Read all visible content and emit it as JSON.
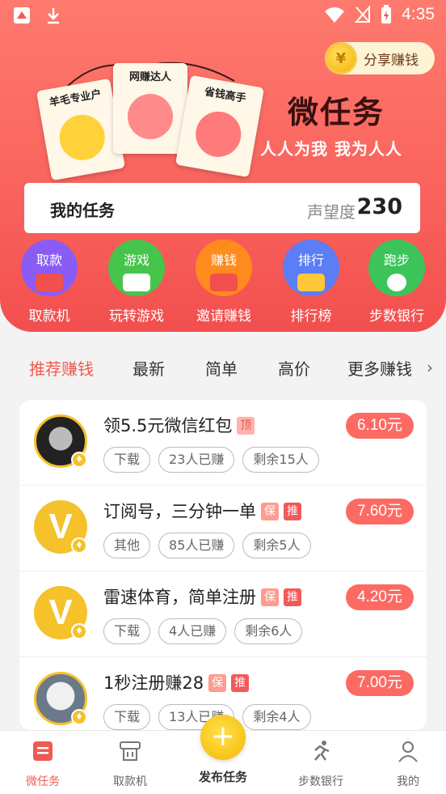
{
  "statusbar": {
    "time": "4:35",
    "app_icon": "app-icon",
    "download_icon": "download-icon",
    "wifi_icon": "wifi-icon",
    "signal_icon": "no-signal-icon",
    "battery_icon": "battery-charging-icon"
  },
  "hero": {
    "share_label": "分享赚钱",
    "coin_symbol": "¥",
    "title": "微任务",
    "subtitle": "人人为我 我为人人",
    "tags": [
      "羊毛专业户",
      "网赚达人",
      "省钱高手"
    ],
    "colors": {
      "gradient_top": "#ff7a6e",
      "gradient_bottom": "#f24f4f"
    }
  },
  "my_task": {
    "title": "我的任务",
    "reputation_label": "声望度",
    "reputation_value": "230"
  },
  "quick_actions": [
    {
      "icon_text": "取款",
      "label": "取款机",
      "color": "#8a5cf5"
    },
    {
      "icon_text": "游戏",
      "label": "玩转游戏",
      "color": "#46c44c"
    },
    {
      "icon_text": "赚钱",
      "label": "邀请赚钱",
      "color": "#ff8a1e"
    },
    {
      "icon_text": "排行",
      "label": "排行榜",
      "color": "#5b7df5"
    },
    {
      "icon_text": "跑步",
      "label": "步数银行",
      "color": "#3cc45a"
    }
  ],
  "tabs": [
    "推荐赚钱",
    "最新",
    "简单",
    "高价",
    "更多赚钱"
  ],
  "tasks": [
    {
      "title": "领5.5元微信红包",
      "badges": [
        "顶"
      ],
      "price": "6.10元",
      "chips": [
        "下载",
        "23人已赚",
        "剩余15人"
      ]
    },
    {
      "title": "订阅号，三分钟一单",
      "badges": [
        "保",
        "推"
      ],
      "price": "7.60元",
      "chips": [
        "其他",
        "85人已赚",
        "剩余5人"
      ]
    },
    {
      "title": "雷速体育，简单注册",
      "badges": [
        "保",
        "推"
      ],
      "price": "4.20元",
      "chips": [
        "下载",
        "4人已赚",
        "剩余6人"
      ]
    },
    {
      "title": "1秒注册赚28",
      "badges": [
        "保",
        "推"
      ],
      "price": "7.00元",
      "chips": [
        "下载",
        "13人已赚",
        "剩余4人"
      ]
    }
  ],
  "avatar_letter": "V",
  "bottom_nav": [
    {
      "label": "微任务"
    },
    {
      "label": "取款机"
    },
    {
      "label": "发布任务"
    },
    {
      "label": "步数银行"
    },
    {
      "label": "我的"
    }
  ],
  "fab_symbol": "+"
}
